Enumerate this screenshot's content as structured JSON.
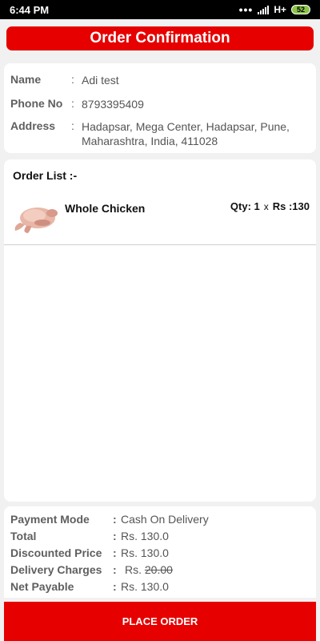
{
  "status_bar": {
    "time": "6:44 PM",
    "network": "H+",
    "battery": "52"
  },
  "header": {
    "title": "Order Confirmation"
  },
  "customer": {
    "name_label": "Name",
    "name_value": "Adi test",
    "phone_label": "Phone No",
    "phone_value": "8793395409",
    "address_label": "Address",
    "address_value": "Hadapsar, Mega Center, Hadapsar, Pune, Maharashtra, India, 411028",
    "colon": ":"
  },
  "order_list": {
    "title": "Order List :-",
    "items": [
      {
        "name": "Whole Chicken",
        "qty": "Qty: 1",
        "times": "x",
        "price": "Rs :130"
      }
    ]
  },
  "summary": {
    "payment_mode_label": "Payment Mode",
    "payment_mode_value": "Cash On Delivery",
    "total_label": "Total",
    "total_value": "Rs. 130.0",
    "discounted_label": "Discounted Price",
    "discounted_value": "Rs. 130.0",
    "delivery_label": "Delivery Charges",
    "delivery_prefix": "Rs.",
    "delivery_value": "20.00",
    "net_label": "Net Payable",
    "net_value": "Rs. 130.0",
    "sep": ":"
  },
  "place_order_label": "PLACE ORDER",
  "colors": {
    "accent": "#e60000",
    "background": "#f1f1f1",
    "card": "#ffffff"
  }
}
